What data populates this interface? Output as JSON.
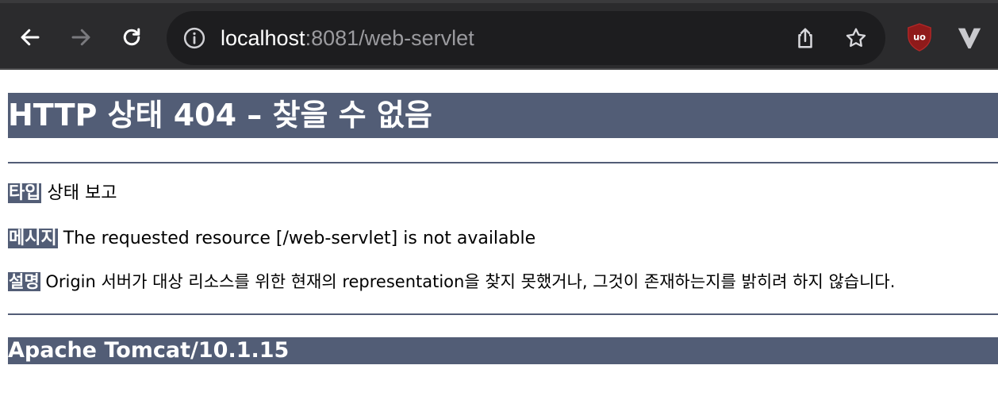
{
  "browser": {
    "url_host": "localhost",
    "url_rest": ":8081/web-servlet",
    "icons": {
      "back": "arrow-left-icon",
      "forward": "arrow-right-icon",
      "reload": "reload-icon",
      "info": "info-icon",
      "share": "share-icon",
      "bookmark": "star-icon",
      "extension_ublock": "ublock-icon",
      "extension_vivaldi": "v-logo-icon"
    }
  },
  "page": {
    "title": "HTTP 상태 404 – 찾을 수 없음",
    "type_label": "타입",
    "type_value": "상태 보고",
    "message_label": "메시지",
    "message_value": "The requested resource [/web-servlet] is not available",
    "description_label": "설명",
    "description_value": "Origin 서버가 대상 리소스를 위한 현재의 representation을 찾지 못했거나, 그것이 존재하는지를 밝히려 하지 않습니다.",
    "footer": "Apache Tomcat/10.1.15"
  },
  "colors": {
    "header_bg": "#525d76",
    "toolbar_bg": "#2b2b2d",
    "omnibox_bg": "#1d1d1f"
  }
}
